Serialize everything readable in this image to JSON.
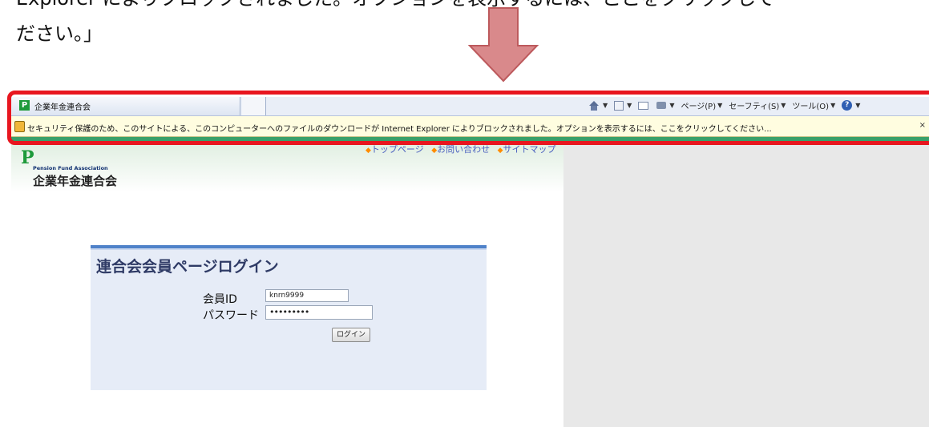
{
  "intro": {
    "line1": "Explorer によりブロックされました。オプションを表示するには、ここをクリックして",
    "line2": "ださい。」"
  },
  "browser": {
    "tab_title": "企業年金連合会",
    "commands": {
      "page": "ページ(P)",
      "safety": "セーフティ(S)",
      "tools": "ツール(O)"
    },
    "infobar_text": "セキュリティ保護のため、このサイトによる、このコンピューターへのファイルのダウンロードが Internet Explorer によりブロックされました。オプションを表示するには、ここをクリックしてください...",
    "infobar_close": "×"
  },
  "site": {
    "logo_mark": "P",
    "logo_en": "Pension Fund Association",
    "logo_jp": "企業年金連合会",
    "nav": [
      "トップページ",
      "お問い合わせ",
      "サイトマップ"
    ]
  },
  "login": {
    "title": "連合会会員ページログイン",
    "id_label": "会員ID",
    "id_value": "knrn9999",
    "pw_label": "パスワード",
    "pw_value": "•••••••••",
    "button": "ログイン"
  },
  "colors": {
    "highlight_border": "#e8161f",
    "arrow_fill": "#d9898b",
    "arrow_stroke": "#bd5a5d"
  },
  "icons": [
    "home-icon",
    "feed-icon",
    "mail-icon",
    "print-icon",
    "help-icon",
    "shield-icon"
  ]
}
